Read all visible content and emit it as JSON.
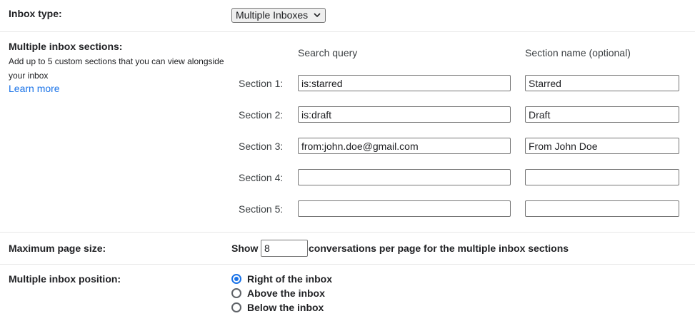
{
  "inbox_type": {
    "label": "Inbox type:",
    "selected": "Multiple Inboxes"
  },
  "sections": {
    "label": "Multiple inbox sections:",
    "description": "Add up to 5 custom sections that you can view alongside your inbox",
    "learn_more": "Learn more",
    "col_query": "Search query",
    "col_name": "Section name (optional)",
    "rows": [
      {
        "label": "Section 1:",
        "query": "is:starred",
        "name": "Starred"
      },
      {
        "label": "Section 2:",
        "query": "is:draft",
        "name": "Draft"
      },
      {
        "label": "Section 3:",
        "query": "from:john.doe@gmail.com",
        "name": "From John Doe"
      },
      {
        "label": "Section 4:",
        "query": "",
        "name": ""
      },
      {
        "label": "Section 5:",
        "query": "",
        "name": ""
      }
    ]
  },
  "page_size": {
    "label": "Maximum page size:",
    "show": "Show",
    "value": "8",
    "suffix": "conversations per page for the multiple inbox sections"
  },
  "position": {
    "label": "Multiple inbox position:",
    "options": [
      {
        "label": "Right of the inbox",
        "checked": true
      },
      {
        "label": "Above the inbox",
        "checked": false
      },
      {
        "label": "Below the inbox",
        "checked": false
      }
    ]
  },
  "colors": {
    "link": "#1a73e8",
    "radio_selected": "#1a73e8"
  }
}
